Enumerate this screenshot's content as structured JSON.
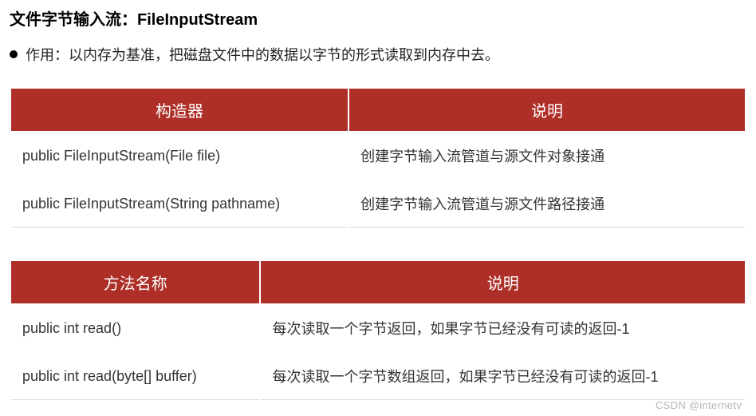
{
  "title": "文件字节输入流：FileInputStream",
  "bullet": "作用：以内存为基准，把磁盘文件中的数据以字节的形式读取到内存中去。",
  "table1": {
    "headers": [
      "构造器",
      "说明"
    ],
    "rows": [
      [
        "public FileInputStream(File file)",
        "创建字节输入流管道与源文件对象接通"
      ],
      [
        "public FileInputStream(String pathname)",
        "创建字节输入流管道与源文件路径接通"
      ]
    ]
  },
  "table2": {
    "headers": [
      "方法名称",
      "说明"
    ],
    "rows": [
      [
        "public int read()",
        "每次读取一个字节返回，如果字节已经没有可读的返回-1"
      ],
      [
        "public int read(byte[] buffer)",
        "每次读取一个字节数组返回，如果字节已经没有可读的返回-1"
      ]
    ]
  },
  "watermark": "CSDN @internetv"
}
